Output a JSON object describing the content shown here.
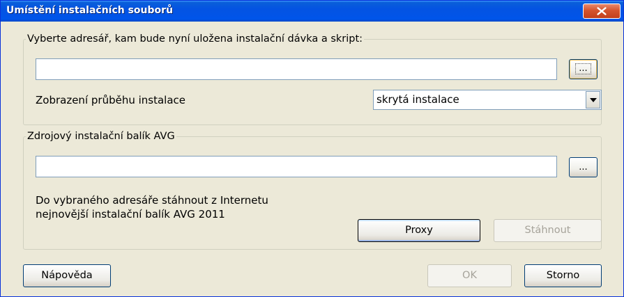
{
  "window": {
    "title": "Umístění instalačních souborů",
    "close_label": "X"
  },
  "target_group": {
    "legend": "Vyberte adresář, kam bude nyní uložena instalační dávka a skript:",
    "path_value": "",
    "browse_label": "...",
    "progress_label": "Zobrazení průběhu instalace",
    "progress_select_value": "skrytá instalace"
  },
  "source_group": {
    "legend": "Zdrojový instalační balík AVG",
    "path_value": "",
    "browse_label": "...",
    "download_text_line1": "Do vybraného adresáře stáhnout z Internetu",
    "download_text_line2": "nejnovější instalační balík AVG 2011",
    "proxy_label": "Proxy",
    "download_label": "Stáhnout"
  },
  "footer": {
    "help_label": "Nápověda",
    "ok_label": "OK",
    "cancel_label": "Storno"
  }
}
